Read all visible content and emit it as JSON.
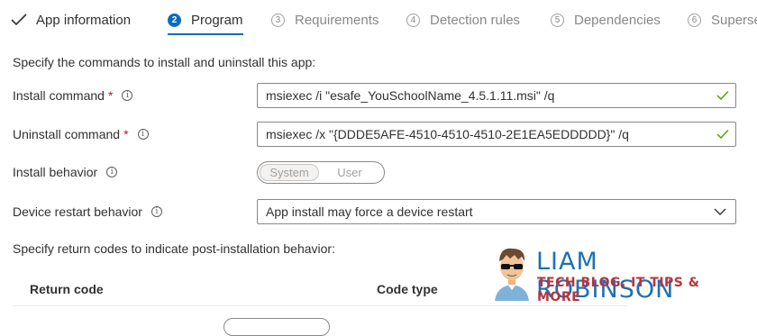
{
  "wizard": {
    "steps": [
      {
        "number": "",
        "label": "App information",
        "state": "completed"
      },
      {
        "number": "2",
        "label": "Program",
        "state": "active"
      },
      {
        "number": "3",
        "label": "Requirements",
        "state": "pending"
      },
      {
        "number": "4",
        "label": "Detection rules",
        "state": "pending"
      },
      {
        "number": "5",
        "label": "Dependencies",
        "state": "pending"
      },
      {
        "number": "6",
        "label": "Superse",
        "state": "pending"
      }
    ]
  },
  "program": {
    "intro": "Specify the commands to install and uninstall this app:",
    "install_command": {
      "label": "Install command",
      "required_mark": "*",
      "value": "msiexec /i \"esafe_YouSchoolName_4.5.1.11.msi\" /q"
    },
    "uninstall_command": {
      "label": "Uninstall command",
      "required_mark": "*",
      "value": "msiexec /x \"{DDDE5AFE-4510-4510-4510-2E1EA5EDDDDD}\" /q"
    },
    "install_behavior": {
      "label": "Install behavior",
      "options": [
        "System",
        "User"
      ],
      "selected": "System"
    },
    "device_restart_behavior": {
      "label": "Device restart behavior",
      "selected": "App install may force a device restart"
    },
    "return_codes": {
      "intro": "Specify return codes to indicate post-installation behavior:",
      "columns": [
        "Return code",
        "Code type"
      ]
    }
  },
  "watermark": {
    "name": "LIAM ROBINSON",
    "tagline": "TECH BLOG, IT TIPS & MORE"
  },
  "colors": {
    "accent": "#0f6cbd",
    "valid_check": "#57a300",
    "required": "#a4262c",
    "logo_name": "#1f6fb5",
    "logo_tagline": "#b4353f"
  },
  "icons": {
    "step_done": "check-icon",
    "info": "info-icon",
    "valid": "checkmark-icon",
    "dropdown": "chevron-down-icon"
  }
}
